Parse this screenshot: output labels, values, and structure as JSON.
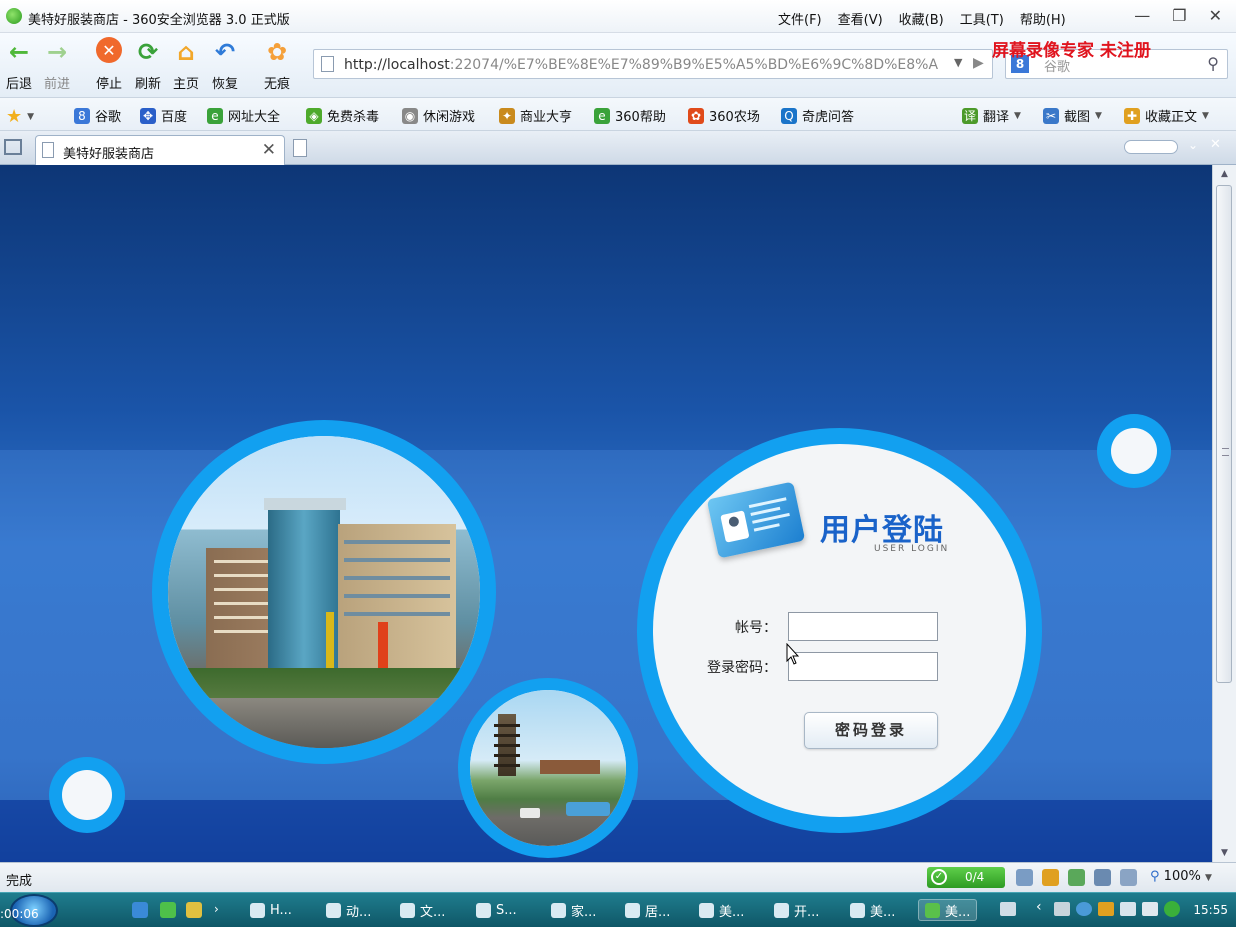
{
  "window": {
    "title": "美特好服装商店 - 360安全浏览器 3.0 正式版",
    "menus": [
      "文件(F)",
      "查看(V)",
      "收藏(B)",
      "工具(T)",
      "帮助(H)"
    ],
    "controls": [
      "—",
      "❐",
      "✕"
    ]
  },
  "toolbar": {
    "buttons": [
      {
        "label": "后退",
        "icon": "back-arrow-icon"
      },
      {
        "label": "前进",
        "icon": "forward-arrow-icon"
      },
      {
        "label": "停止",
        "icon": "stop-icon"
      },
      {
        "label": "刷新",
        "icon": "refresh-icon"
      },
      {
        "label": "主页",
        "icon": "home-icon"
      },
      {
        "label": "恢复",
        "icon": "undo-icon"
      },
      {
        "label": "无痕",
        "icon": "incognito-icon"
      }
    ],
    "url_host": "http://localhost",
    "url_rest": ":22074/%E7%BE%8E%E7%89%B9%E5%A5%BD%E6%9C%8D%E8%A",
    "search_placeholder": "谷歌",
    "watermark": "屏幕录像专家  未注册"
  },
  "favorites": {
    "items": [
      "谷歌",
      "百度",
      "网址大全",
      "免费杀毒",
      "休闲游戏",
      "商业大亨",
      "360帮助",
      "360农场",
      "奇虎问答"
    ],
    "right_items": [
      "翻译",
      "截图",
      "收藏正文"
    ]
  },
  "tabs": {
    "active_title": "美特好服装商店"
  },
  "login": {
    "title": "用户登陆",
    "subtitle": "USER LOGIN",
    "account_label": "帐号：",
    "password_label": "登录密码：",
    "account_value": "",
    "password_value": "",
    "submit_label": "密码登录"
  },
  "status": {
    "text": "完成",
    "downloads": "0/4",
    "zoom": "100%"
  },
  "taskbar": {
    "recorder_time": ":00:06",
    "items": [
      "H...",
      "动...",
      "文...",
      "S...",
      "家...",
      "居...",
      "美...",
      "开...",
      "美...",
      "美..."
    ],
    "clock": "15:55"
  },
  "colors": {
    "page_bg": "#1a54a8",
    "ring": "#12a0f0",
    "login_title": "#1a63c9",
    "watermark": "#e0141e"
  }
}
